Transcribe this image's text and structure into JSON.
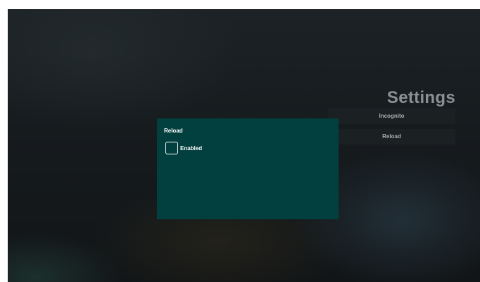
{
  "screen": {
    "title": "Settings"
  },
  "menu": {
    "items": [
      {
        "label": "Incognito"
      },
      {
        "label": "Reload"
      }
    ]
  },
  "dialog": {
    "title": "Reload",
    "checkbox": {
      "label": "Enabled",
      "checked": false
    }
  }
}
